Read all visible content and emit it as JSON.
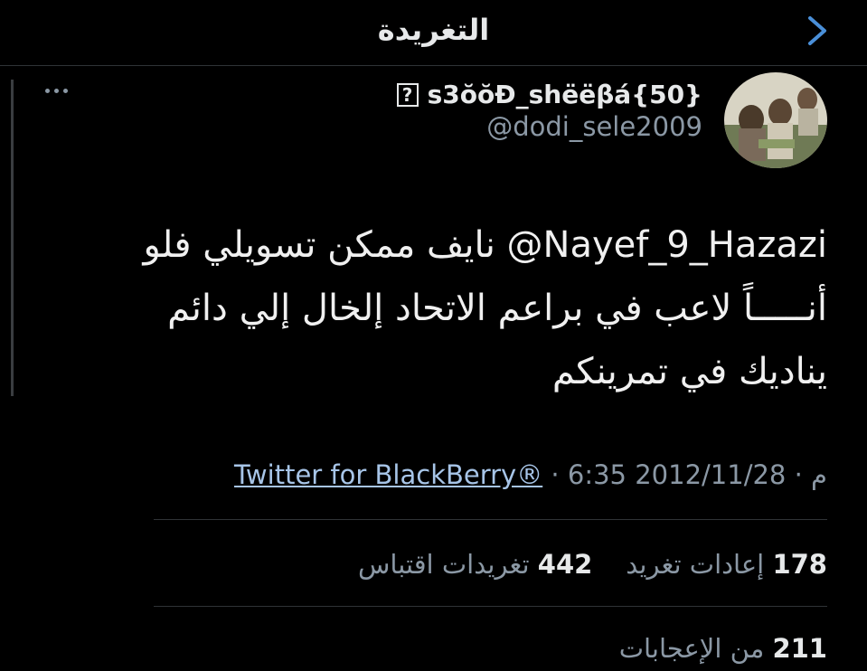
{
  "header": {
    "title": "التغريدة",
    "back_icon": "chevron-back-icon"
  },
  "tweet": {
    "display_name": "s3ŏŏÐ_shëëβá{50}",
    "unknown_glyph": "?",
    "handle": "@dodi_sele2009",
    "more_icon": "more-horizontal-icon",
    "mention": "Nayef_9_Hazazi@",
    "text_line1_rest": " نايف ممكن تسويلي فلو",
    "text_line2": "أنـــــاً لاعب في براعم الاتحاد إلخال إلي دائم",
    "text_line3": "يناديك في تمرينكم",
    "date": "2012/11/28",
    "time": "6:35 م",
    "sep": " · ",
    "source": "Twitter for BlackBerry®"
  },
  "stats": {
    "retweets_count": "178",
    "retweets_label": "إعادات تغريد",
    "quotes_count": "442",
    "quotes_label": "تغريدات اقتباس",
    "likes_count": "211",
    "likes_label": "من الإعجابات"
  },
  "colors": {
    "background": "#000000",
    "text": "#e7e9ea",
    "muted": "#8b98a5",
    "link": "#a7c5e8",
    "divider": "#2f3336"
  }
}
